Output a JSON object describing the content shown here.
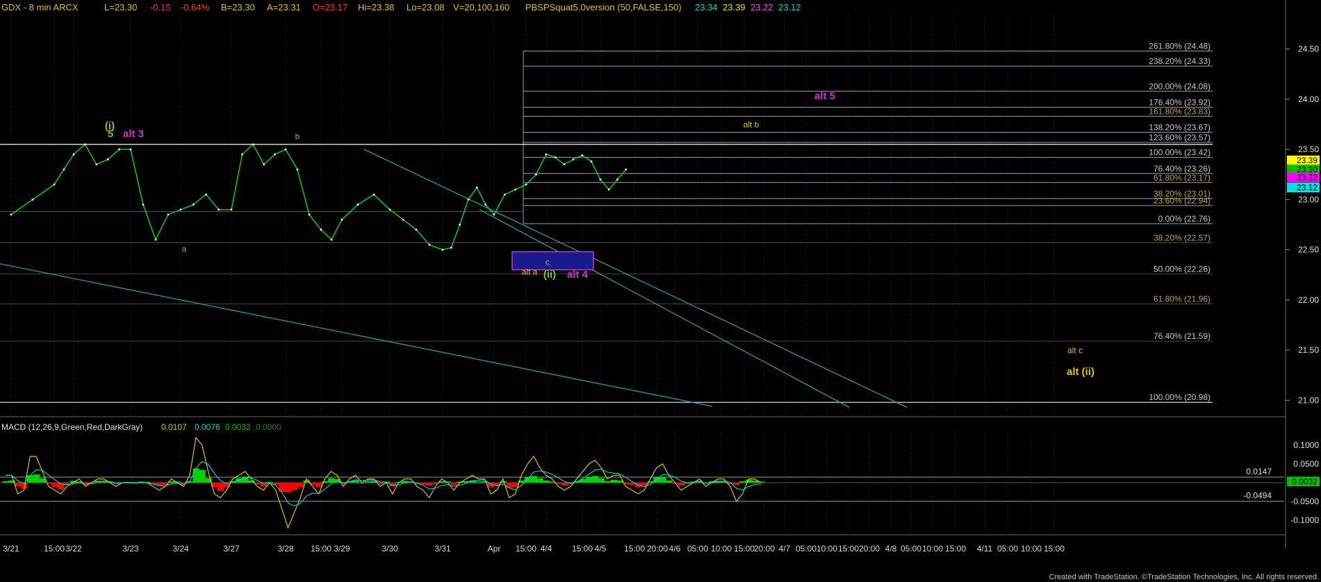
{
  "header": {
    "symbol": "GDX - 8 min  ARCX",
    "last": "L=23.30",
    "change": "-0.15",
    "change_pct": "-0.64%",
    "bid": "B=23.30",
    "ask": "A=23.31",
    "open": "O=23.17",
    "high": "Hi=23.38",
    "low": "Lo=23.08",
    "volume": "V=20,100,160",
    "indicator": "PBSPSquat5.0version (50,FALSE,150)",
    "ind_values": [
      "23.34",
      "23.39",
      "23.22",
      "23.12"
    ]
  },
  "colors": {
    "background": "#000000",
    "price": "#00e000",
    "fib_line": "#9aa0a8",
    "fib_text": "#c8c8c8",
    "fib_gold_text": "#b8a44a",
    "trend": "#2aa8a8",
    "wave_green": "#7dc242",
    "wave_magenta": "#cc33cc",
    "wave_yellow": "#e0c020",
    "macd_up": "#00d000",
    "macd_down": "#ff0000"
  },
  "chart_data": [
    {
      "type": "line",
      "title": "",
      "xlabel": "",
      "ylabel": "",
      "x_tick_labels": [
        "3/21",
        "15:00",
        "3/22",
        "3/23",
        "3/24",
        "3/27",
        "3/28",
        "15:00",
        "3/29",
        "3/30",
        "3/31",
        "Apr",
        "15:00",
        "4/4",
        "15:00",
        "4/5",
        "15:00",
        "20:00",
        "4/6",
        "05:00",
        "10:00",
        "15:00",
        "20:00",
        "4/7",
        "05:00",
        "10:00",
        "15:00",
        "20:00",
        "4/8",
        "05:00",
        "10:00",
        "15:00",
        "4/11",
        "05:00",
        "10:00",
        "15:00"
      ],
      "ylim": [
        20.85,
        24.85
      ],
      "y_ticks": [
        "24.50",
        "24.00",
        "23.50",
        "23.00",
        "22.50",
        "22.00",
        "21.50",
        "21.00"
      ],
      "price_path": [
        [
          "3/21",
          22.85
        ],
        [
          "3/21",
          23.0
        ],
        [
          "3/21 15:00",
          23.15
        ],
        [
          "3/21 15:00",
          23.3
        ],
        [
          "3/22",
          23.45
        ],
        [
          "3/22",
          23.55
        ],
        [
          "3/22",
          23.35
        ],
        [
          "3/22",
          23.4
        ],
        [
          "3/22",
          23.5
        ],
        [
          "3/23",
          23.5
        ],
        [
          "3/23",
          22.95
        ],
        [
          "3/23",
          22.6
        ],
        [
          "3/23",
          22.85
        ],
        [
          "3/24",
          22.9
        ],
        [
          "3/24",
          22.95
        ],
        [
          "3/24",
          23.05
        ],
        [
          "3/24",
          22.9
        ],
        [
          "3/27",
          22.9
        ],
        [
          "3/27",
          23.45
        ],
        [
          "3/27",
          23.55
        ],
        [
          "3/27",
          23.35
        ],
        [
          "3/27",
          23.45
        ],
        [
          "3/28",
          23.5
        ],
        [
          "3/28",
          23.3
        ],
        [
          "3/28",
          22.85
        ],
        [
          "3/28 15:00",
          22.7
        ],
        [
          "3/28 15:00",
          22.6
        ],
        [
          "3/29",
          22.8
        ],
        [
          "3/29",
          22.95
        ],
        [
          "3/29",
          23.05
        ],
        [
          "3/30",
          22.9
        ],
        [
          "3/30",
          22.8
        ],
        [
          "3/30",
          22.7
        ],
        [
          "3/30",
          22.55
        ],
        [
          "3/31",
          22.5
        ],
        [
          "3/31",
          22.52
        ],
        [
          "3/31",
          22.75
        ],
        [
          "3/31",
          23.0
        ],
        [
          "3/31",
          23.12
        ],
        [
          "3/31",
          22.95
        ],
        [
          "Apr",
          22.85
        ],
        [
          "Apr",
          23.05
        ],
        [
          "Apr",
          23.1
        ],
        [
          "Apr 15:00",
          23.15
        ],
        [
          "Apr 15:00",
          23.25
        ],
        [
          "4/4",
          23.45
        ],
        [
          "4/4",
          23.42
        ],
        [
          "4/4",
          23.35
        ],
        [
          "4/4",
          23.4
        ],
        [
          "4/4 15:00",
          23.44
        ],
        [
          "4/4 15:00",
          23.38
        ],
        [
          "4/5",
          23.2
        ],
        [
          "4/5",
          23.1
        ],
        [
          "4/5",
          23.2
        ],
        [
          "4/5",
          23.3
        ]
      ],
      "last_price": "23.30",
      "fib_levels": [
        {
          "label": "261.80% (24.48)",
          "value": 24.48
        },
        {
          "label": "238.20% (24.33)",
          "value": 24.33
        },
        {
          "label": "200.00% (24.08)",
          "value": 24.08
        },
        {
          "label": "176.40% (23.92)",
          "value": 23.92
        },
        {
          "label": "161.80% (23.83)",
          "value": 23.83
        },
        {
          "label": "138.20% (23.67)",
          "value": 23.67
        },
        {
          "label": "123.60% (23.57)",
          "value": 23.57
        },
        {
          "label": "100.00% (23.42)",
          "value": 23.42
        },
        {
          "label": "76.40% (23.26)",
          "value": 23.26
        },
        {
          "label": "61.80% (23.17)",
          "value": 23.17
        },
        {
          "label": "38.20% (23.01)",
          "value": 23.01
        },
        {
          "label": "23.60% (22.94)",
          "value": 22.94
        },
        {
          "label": "0.00% (22.76)",
          "value": 22.76
        },
        {
          "label": "38.20% (22.57)",
          "value": 22.57
        },
        {
          "label": "50.00% (22.26)",
          "value": 22.26
        },
        {
          "label": "61.80% (21.96)",
          "value": 21.96
        },
        {
          "label": "76.40% (21.59)",
          "value": 21.59
        },
        {
          "label": "100.00% (20.98)",
          "value": 20.98
        }
      ],
      "right_tags": [
        {
          "label": "23.39",
          "value": 23.39,
          "color": "#ffff00",
          "text": "#000000"
        },
        {
          "label": "23.30",
          "value": 23.3,
          "color": "#00c000",
          "text": "#000000"
        },
        {
          "label": "23.22",
          "value": 23.22,
          "color": "#ff00ff",
          "text": "#000000"
        },
        {
          "label": "23.12",
          "value": 23.12,
          "color": "#00e0e0",
          "text": "#000000"
        }
      ],
      "wave_labels": [
        {
          "text": "(i)",
          "x": "3/22",
          "y": 23.7,
          "color": "#7dc242",
          "weight": "bold"
        },
        {
          "text": "5",
          "x": "3/22",
          "y": 23.62,
          "color": "#7dc242",
          "weight": "bold"
        },
        {
          "text": "alt 3",
          "x": "3/22",
          "y": 23.62,
          "color": "#cc33cc",
          "weight": "bold"
        },
        {
          "text": "b",
          "x": "3/27",
          "y": 23.6,
          "color": "#7dc242",
          "weight": "normal"
        },
        {
          "text": "a",
          "x": "3/23",
          "y": 22.48,
          "color": "#7dc242",
          "weight": "normal"
        },
        {
          "text": "alt a",
          "x": "3/31",
          "y": 22.25,
          "color": "#e0c020",
          "weight": "normal"
        },
        {
          "text": "(ii)",
          "x": "3/31",
          "y": 22.22,
          "color": "#7dc242",
          "weight": "bold"
        },
        {
          "text": "c",
          "x": "3/31",
          "y": 22.35,
          "color": "#7dc242",
          "weight": "normal"
        },
        {
          "text": "alt 4",
          "x": "3/31",
          "y": 22.22,
          "color": "#cc33cc",
          "weight": "bold"
        },
        {
          "text": "alt 5",
          "x": "4/4",
          "y": 24.0,
          "color": "#cc33cc",
          "weight": "bold"
        },
        {
          "text": "alt b",
          "x": "4/5",
          "y": 23.72,
          "color": "#e0c020",
          "weight": "normal"
        },
        {
          "text": "alt c",
          "x": "4/8",
          "y": 21.47,
          "color": "#e0c020",
          "weight": "normal"
        },
        {
          "text": "alt (ii)",
          "x": "4/8",
          "y": 21.25,
          "color": "#e0c020",
          "weight": "bold"
        }
      ]
    },
    {
      "type": "bar",
      "title": "MACD (12,26,9,Green,Red,DarkGray)",
      "legend_values": [
        "0.0107",
        "0.0076",
        "0.0032",
        "0.0000"
      ],
      "ylim": [
        -0.135,
        0.135
      ],
      "y_ticks": [
        "0.1000",
        "0.0500",
        "0.0000",
        "-0.0500",
        "-0.1000"
      ],
      "reference_levels": [
        {
          "label": "0.0147",
          "value": 0.0147
        },
        {
          "label": "-0.0494",
          "value": -0.0494
        }
      ],
      "last_value": "0.0032",
      "histogram": [
        0.004,
        0.006,
        -0.01,
        -0.016,
        0.02,
        0.022,
        0.012,
        -0.003,
        -0.012,
        -0.018,
        -0.006,
        0.005,
        0.003,
        -0.006,
        -0.004,
        0.005,
        0.004,
        0.003,
        -0.004,
        -0.002,
        0.002,
        -0.003,
        0.003,
        0.002,
        -0.004,
        -0.008,
        -0.006,
        0.004,
        0.003,
        -0.003,
        0.004,
        0.038,
        0.034,
        0.012,
        -0.012,
        -0.022,
        -0.012,
        0.004,
        0.012,
        0.016,
        0.006,
        -0.004,
        -0.01,
        0.002,
        -0.006,
        -0.024,
        -0.026,
        -0.02,
        -0.012,
        0.006,
        -0.006,
        -0.012,
        0.004,
        0.012,
        0.01,
        -0.004,
        0.004,
        0.006,
        -0.003,
        0.004,
        0.005,
        -0.004,
        0.003,
        -0.01,
        0.002,
        0.005,
        0.003,
        -0.004,
        -0.006,
        -0.008,
        -0.004,
        0.004,
        0.003,
        -0.006,
        0.003,
        0.004,
        0.006,
        0.003,
        0.004,
        -0.012,
        -0.008,
        0.004,
        -0.014,
        -0.012,
        0.006,
        0.014,
        0.018,
        0.012,
        0.006,
        0.003,
        -0.003,
        -0.008,
        -0.004,
        0.004,
        0.01,
        0.016,
        0.018,
        0.012,
        0.004,
        0.008,
        0.006,
        -0.004,
        -0.006,
        -0.012,
        -0.008,
        0.004,
        0.014,
        0.016,
        0.006,
        -0.003,
        -0.008,
        -0.004,
        0.003,
        0.005,
        -0.003,
        0.004,
        0.005,
        0.003,
        -0.004,
        -0.006,
        0.004,
        0.008,
        0.006,
        0.003
      ],
      "macd_line": [
        0.02,
        0.02,
        -0.03,
        -0.02,
        0.07,
        0.07,
        0.03,
        -0.01,
        -0.02,
        -0.03,
        -0.01,
        0.0,
        0.01,
        -0.01,
        0.0,
        0.01,
        0.01,
        0.0,
        -0.01,
        0.0,
        0.0,
        0.0,
        0.0,
        0.0,
        -0.01,
        -0.02,
        -0.01,
        0.01,
        0.0,
        -0.01,
        0.02,
        0.12,
        0.1,
        0.03,
        -0.03,
        -0.04,
        -0.02,
        0.01,
        0.02,
        0.03,
        0.01,
        -0.01,
        -0.02,
        0.0,
        -0.02,
        -0.07,
        -0.12,
        -0.08,
        -0.04,
        0.01,
        -0.01,
        -0.03,
        0.01,
        0.03,
        0.02,
        -0.01,
        0.01,
        0.02,
        0.0,
        0.01,
        0.01,
        -0.01,
        0.0,
        -0.03,
        0.0,
        0.01,
        0.01,
        -0.01,
        -0.02,
        -0.04,
        -0.01,
        0.01,
        0.0,
        -0.02,
        0.0,
        0.01,
        0.02,
        0.01,
        0.01,
        -0.03,
        -0.02,
        0.01,
        -0.04,
        -0.03,
        0.02,
        0.05,
        0.07,
        0.04,
        0.02,
        0.01,
        -0.01,
        -0.02,
        -0.01,
        0.01,
        0.03,
        0.05,
        0.06,
        0.04,
        0.01,
        0.02,
        0.02,
        -0.01,
        -0.02,
        -0.03,
        -0.02,
        0.01,
        0.04,
        0.05,
        0.02,
        0.0,
        -0.02,
        -0.01,
        0.0,
        0.01,
        -0.01,
        0.0,
        0.01,
        0.01,
        -0.01,
        -0.05,
        -0.03,
        0.01,
        0.01,
        0.0
      ],
      "x_tick_labels": [
        "3/21",
        "15:00",
        "3/22",
        "3/23",
        "3/24",
        "3/27",
        "3/28",
        "15:00",
        "3/29",
        "3/30",
        "3/31",
        "Apr",
        "15:00",
        "4/4",
        "15:00",
        "4/5",
        "15:00",
        "20:00",
        "4/6",
        "05:00",
        "10:00",
        "15:00",
        "20:00",
        "4/7",
        "05:00",
        "10:00",
        "15:00",
        "20:00",
        "4/8",
        "05:00",
        "10:00",
        "15:00",
        "4/11",
        "05:00",
        "10:00",
        "15:00"
      ]
    }
  ],
  "footer": {
    "credit": "Created with TradeStation. ©TradeStation Technologies, Inc. All rights reserved."
  }
}
